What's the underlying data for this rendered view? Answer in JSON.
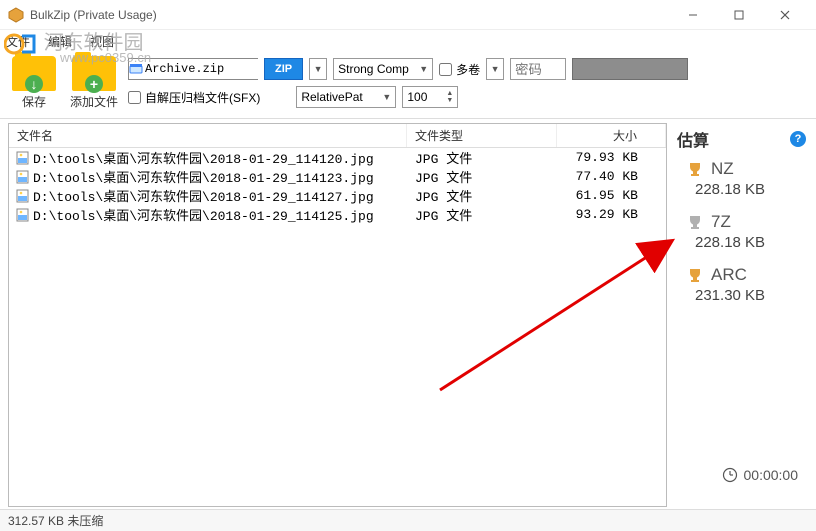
{
  "window": {
    "title": "BulkZip (Private Usage)"
  },
  "menu": {
    "file": "文件",
    "edit": "编辑",
    "view": "视图"
  },
  "watermark": {
    "text": "河东软件园",
    "url": "www.pc0359.cn"
  },
  "toolbar": {
    "save_label": "保存",
    "add_label": "添加文件",
    "archive_name": "Archive.zip",
    "zip_label": "ZIP",
    "comp_label": "Strong Comp",
    "multivol_label": "多卷",
    "password_placeholder": "密码",
    "sfx_label": "自解压归档文件(SFX)",
    "relpath_label": "RelativePat",
    "spin_value": "100"
  },
  "columns": {
    "name": "文件名",
    "type": "文件类型",
    "size": "大小"
  },
  "files": [
    {
      "name": "D:\\tools\\桌面\\河东软件园\\2018-01-29_114120.jpg",
      "type": "JPG 文件",
      "size": "79.93 KB"
    },
    {
      "name": "D:\\tools\\桌面\\河东软件园\\2018-01-29_114123.jpg",
      "type": "JPG 文件",
      "size": "77.40 KB"
    },
    {
      "name": "D:\\tools\\桌面\\河东软件园\\2018-01-29_114127.jpg",
      "type": "JPG 文件",
      "size": "61.95 KB"
    },
    {
      "name": "D:\\tools\\桌面\\河东软件园\\2018-01-29_114125.jpg",
      "type": "JPG 文件",
      "size": "93.29 KB"
    }
  ],
  "sidebar": {
    "title": "估算",
    "estimates": [
      {
        "fmt": "NZ",
        "size": "228.18 KB",
        "trophy": "gold"
      },
      {
        "fmt": "7Z",
        "size": "228.18 KB",
        "trophy": "silver"
      },
      {
        "fmt": "ARC",
        "size": "231.30 KB",
        "trophy": "gold"
      }
    ],
    "timer": "00:00:00"
  },
  "status": {
    "text": "312.57 KB 未压缩"
  }
}
